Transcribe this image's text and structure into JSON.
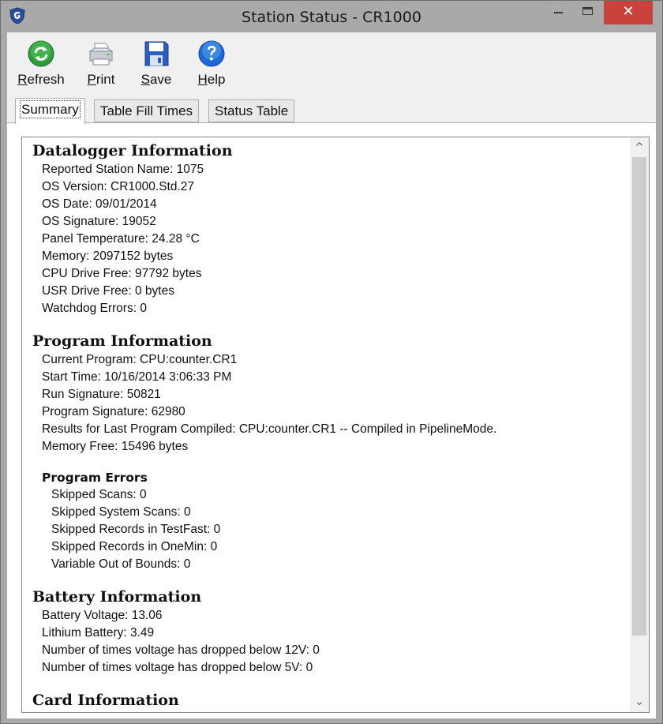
{
  "window": {
    "title": "Station Status - CR1000",
    "close_symbol": "✕"
  },
  "toolbar": {
    "refresh": {
      "accel": "R",
      "rest": "efresh",
      "icon": "refresh-icon"
    },
    "print": {
      "accel": "P",
      "rest": "rint",
      "icon": "printer-icon"
    },
    "save": {
      "accel": "S",
      "rest": "ave",
      "icon": "save-icon"
    },
    "help": {
      "pre": "",
      "accel": "H",
      "rest": "elp",
      "icon": "help-icon"
    }
  },
  "tabs": [
    {
      "label": "Summary",
      "active": true
    },
    {
      "label": "Table Fill Times",
      "active": false
    },
    {
      "label": "Status Table",
      "active": false
    }
  ],
  "summary": {
    "datalogger": {
      "title": "Datalogger Information",
      "lines": [
        "Reported Station Name: 1075",
        "OS Version: CR1000.Std.27",
        "OS Date: 09/01/2014",
        "OS Signature: 19052",
        "Panel Temperature: 24.28 °C",
        "Memory: 2097152 bytes",
        "CPU Drive Free: 97792 bytes",
        "USR Drive Free: 0 bytes",
        "Watchdog Errors: 0"
      ]
    },
    "program": {
      "title": "Program Information",
      "lines": [
        "Current Program: CPU:counter.CR1",
        "Start Time: 10/16/2014 3:06:33 PM",
        "Run Signature: 50821",
        "Program Signature: 62980",
        "Results for Last Program Compiled: CPU:counter.CR1 -- Compiled in PipelineMode.",
        "Memory Free: 15496 bytes"
      ],
      "errors_title": "Program Errors",
      "errors": [
        "Skipped Scans: 0",
        "Skipped System Scans: 0",
        "Skipped Records in TestFast:  0",
        "Skipped Records in OneMin:  0",
        "Variable Out of Bounds: 0"
      ]
    },
    "battery": {
      "title": "Battery Information",
      "lines": [
        "Battery Voltage: 13.06",
        "Lithium Battery: 3.49",
        "Number of times voltage has dropped below 12V: 0",
        "Number of times voltage has dropped below 5V: 0"
      ]
    },
    "card": {
      "title": "Card Information"
    }
  },
  "scrollbar": {
    "up_arrow": "^",
    "down_arrow": "⌄"
  },
  "colors": {
    "title_bar": "#a9a9a9",
    "close_button": "#c8423b",
    "window_bg": "#f0f0f0",
    "scroll_thumb": "#cdcdcd"
  }
}
